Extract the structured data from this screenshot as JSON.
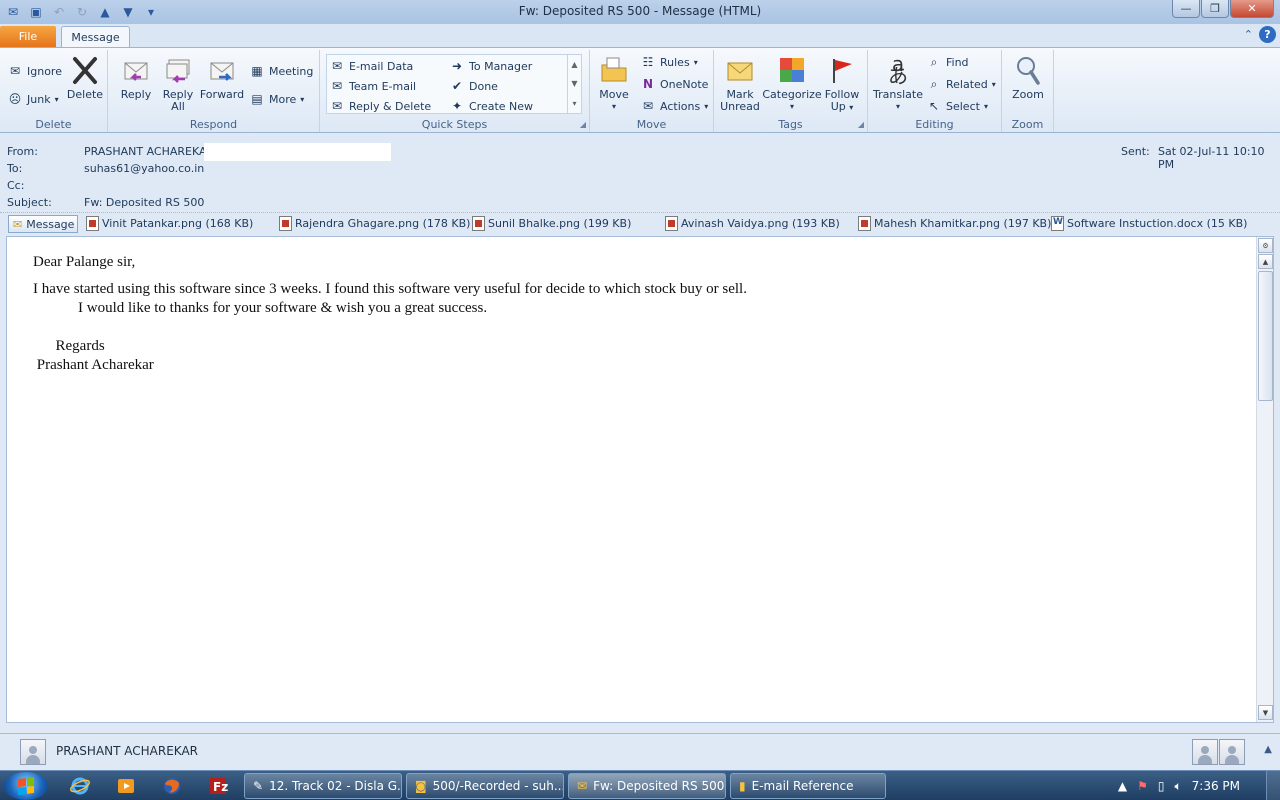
{
  "window": {
    "title": "Fw: Deposited RS 500  -  Message (HTML)",
    "controls": {
      "minimize": "—",
      "maximize": "❐",
      "close": "✕"
    }
  },
  "tabs": {
    "file": "File",
    "message": "Message"
  },
  "ribbon": {
    "delete_group": {
      "label": "Delete",
      "ignore": "Ignore",
      "junk": "Junk",
      "delete": "Delete"
    },
    "respond_group": {
      "label": "Respond",
      "reply": "Reply",
      "reply_all_1": "Reply",
      "reply_all_2": "All",
      "forward": "Forward",
      "meeting": "Meeting",
      "more": "More"
    },
    "quicksteps_group": {
      "label": "Quick Steps",
      "email_data": "E-mail Data",
      "team_email": "Team E-mail",
      "reply_delete": "Reply & Delete",
      "to_manager": "To Manager",
      "done": "Done",
      "create_new": "Create New"
    },
    "move_group": {
      "label": "Move",
      "move": "Move",
      "rules": "Rules",
      "onenote": "OneNote",
      "actions": "Actions"
    },
    "tags_group": {
      "label": "Tags",
      "mark_unread_1": "Mark",
      "mark_unread_2": "Unread",
      "categorize": "Categorize",
      "follow_up_1": "Follow",
      "follow_up_2": "Up"
    },
    "editing_group": {
      "label": "Editing",
      "translate": "Translate",
      "find": "Find",
      "related": "Related",
      "select": "Select"
    },
    "zoom_group": {
      "label": "Zoom",
      "zoom": "Zoom"
    }
  },
  "header": {
    "from_label": "From:",
    "from_value": "PRASHANT ACHAREKAR",
    "to_label": "To:",
    "to_value": "suhas61@yahoo.co.in",
    "cc_label": "Cc:",
    "subject_label": "Subject:",
    "subject_value": "Fw: Deposited RS 500",
    "sent_label": "Sent:",
    "sent_value": "Sat 02-Jul-11 10:10 PM"
  },
  "attachments": {
    "message_label": "Message",
    "items": [
      "Vinit Patankar.png (168 KB)",
      "Rajendra Ghagare.png (178 KB)",
      "Sunil Bhalke.png (199 KB)",
      "Avinash Vaidya.png (193 KB)",
      "Mahesh Khamitkar.png (197 KB)",
      "Software Instuction.docx (15 KB)"
    ]
  },
  "body": {
    "lines": [
      "Dear Palange sir,",
      "I have started using this software since 3 weeks. I found this software very useful for decide to which stock buy or sell.",
      "            I would like to thanks for your software & wish you a great success.",
      "",
      "      Regards",
      " Prashant Acharekar"
    ]
  },
  "people_pane": {
    "name": "PRASHANT ACHAREKAR"
  },
  "taskbar": {
    "tasks": [
      "12. Track 02 - Disla G...",
      "500/-Recorded - suh...",
      "Fw: Deposited RS 500...",
      "E-mail Reference"
    ],
    "clock": "7:36 PM"
  }
}
